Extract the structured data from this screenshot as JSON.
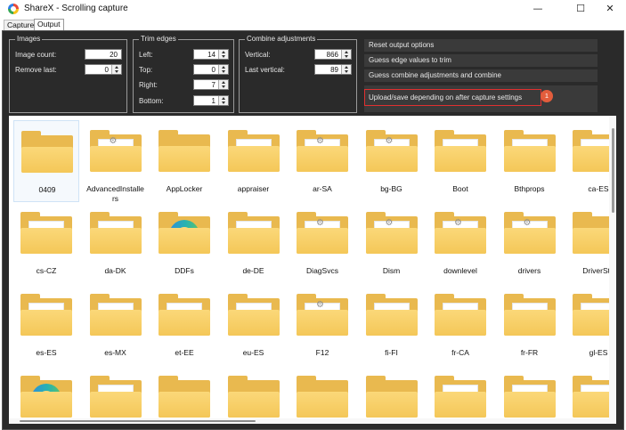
{
  "window": {
    "title": "ShareX - Scrolling capture",
    "minimize": "—",
    "maximize": "☐",
    "close": "✕"
  },
  "tabs": [
    {
      "label": "Capture"
    },
    {
      "label": "Output"
    }
  ],
  "images_group": {
    "legend": "Images",
    "image_count_label": "Image count:",
    "image_count_value": "20",
    "remove_last_label": "Remove last:",
    "remove_last_value": "0"
  },
  "trim_group": {
    "legend": "Trim edges",
    "left_label": "Left:",
    "left_value": "14",
    "top_label": "Top:",
    "top_value": "0",
    "right_label": "Right:",
    "right_value": "7",
    "bottom_label": "Bottom:",
    "bottom_value": "1"
  },
  "combine_group": {
    "legend": "Combine adjustments",
    "vertical_label": "Vertical:",
    "vertical_value": "866",
    "last_vertical_label": "Last vertical:",
    "last_vertical_value": "89"
  },
  "actions": {
    "reset": "Reset output options",
    "guess_edge": "Guess edge values to trim",
    "guess_combine": "Guess combine adjustments and combine",
    "upload": "Upload/save depending on after capture settings",
    "badge": "1"
  },
  "colors": {
    "panel": "#2a2a2a",
    "highlight": "#e03030",
    "badge": "#e35d3c",
    "folder": "#f4c758"
  },
  "folders": [
    {
      "name": "0409",
      "icon": "folder-plain-icon"
    },
    {
      "name": "AdvancedInstallers",
      "icon": "folder-settings-icon"
    },
    {
      "name": "AppLocker",
      "icon": "folder-plain-icon"
    },
    {
      "name": "appraiser",
      "icon": "folder-document-icon"
    },
    {
      "name": "ar-SA",
      "icon": "folder-settings-icon"
    },
    {
      "name": "bg-BG",
      "icon": "folder-settings-icon"
    },
    {
      "name": "Boot",
      "icon": "folder-document-icon"
    },
    {
      "name": "Bthprops",
      "icon": "folder-document-icon"
    },
    {
      "name": "ca-ES",
      "icon": "folder-document-icon"
    },
    {
      "name": "cs-CZ",
      "icon": "folder-document-icon"
    },
    {
      "name": "da-DK",
      "icon": "folder-document-icon"
    },
    {
      "name": "DDFs",
      "icon": "folder-edge-icon"
    },
    {
      "name": "de-DE",
      "icon": "folder-document-icon"
    },
    {
      "name": "DiagSvcs",
      "icon": "folder-settings-icon"
    },
    {
      "name": "Dism",
      "icon": "folder-settings-icon"
    },
    {
      "name": "downlevel",
      "icon": "folder-settings-icon"
    },
    {
      "name": "drivers",
      "icon": "folder-settings-icon"
    },
    {
      "name": "DriverSta",
      "icon": "folder-plain-icon"
    },
    {
      "name": "es-ES",
      "icon": "folder-document-icon"
    },
    {
      "name": "es-MX",
      "icon": "folder-document-icon"
    },
    {
      "name": "et-EE",
      "icon": "folder-document-icon"
    },
    {
      "name": "eu-ES",
      "icon": "folder-document-icon"
    },
    {
      "name": "F12",
      "icon": "folder-settings-icon"
    },
    {
      "name": "fi-FI",
      "icon": "folder-document-icon"
    },
    {
      "name": "fr-CA",
      "icon": "folder-document-icon"
    },
    {
      "name": "fr-FR",
      "icon": "folder-document-icon"
    },
    {
      "name": "gl-ES",
      "icon": "folder-document-icon"
    },
    {
      "name": "",
      "icon": "folder-edge-icon"
    },
    {
      "name": "",
      "icon": "folder-document-icon"
    },
    {
      "name": "",
      "icon": "folder-plain-icon"
    },
    {
      "name": "",
      "icon": "folder-plain-icon"
    },
    {
      "name": "",
      "icon": "folder-plain-icon"
    },
    {
      "name": "",
      "icon": "folder-plain-icon"
    },
    {
      "name": "",
      "icon": "folder-document-icon"
    },
    {
      "name": "",
      "icon": "folder-document-icon"
    },
    {
      "name": "",
      "icon": "folder-document-icon"
    }
  ]
}
